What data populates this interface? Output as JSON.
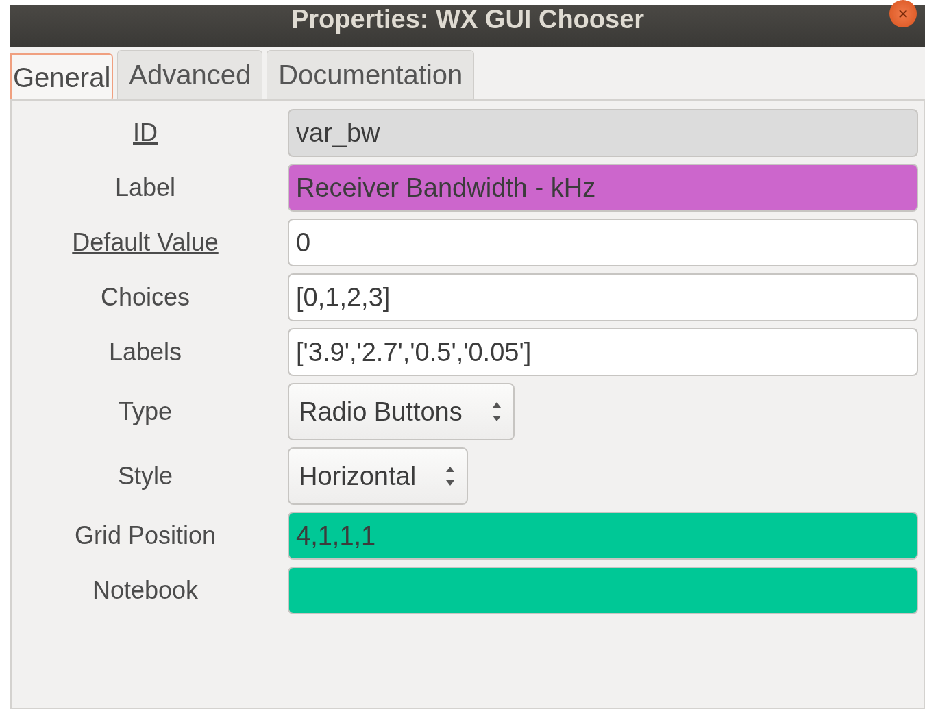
{
  "window": {
    "title": "Properties: WX GUI Chooser",
    "close": "×"
  },
  "tabs": [
    {
      "label": "General",
      "selected": true
    },
    {
      "label": "Advanced",
      "selected": false
    },
    {
      "label": "Documentation",
      "selected": false
    }
  ],
  "fields": [
    {
      "label": "ID",
      "underlined": true,
      "kind": "text",
      "value": "var_bw",
      "color": "#dcdcdc"
    },
    {
      "label": "Label",
      "underlined": false,
      "kind": "text",
      "value": "Receiver Bandwidth - kHz",
      "color": "#cc66cc"
    },
    {
      "label": "Default Value",
      "underlined": true,
      "kind": "text",
      "value": "0",
      "color": "#ffffff"
    },
    {
      "label": "Choices",
      "underlined": false,
      "kind": "text",
      "value": "[0,1,2,3]",
      "color": "#ffffff"
    },
    {
      "label": "Labels",
      "underlined": false,
      "kind": "text",
      "value": "['3.9','2.7','0.5','0.05']",
      "color": "#ffffff"
    },
    {
      "label": "Type",
      "underlined": false,
      "kind": "select",
      "value": "Radio Buttons"
    },
    {
      "label": "Style",
      "underlined": false,
      "kind": "select",
      "value": "Horizontal"
    },
    {
      "label": "Grid Position",
      "underlined": false,
      "kind": "text",
      "value": "4,1,1,1",
      "color": "#00c896"
    },
    {
      "label": "Notebook",
      "underlined": false,
      "kind": "text",
      "color": "#00c896"
    }
  ]
}
